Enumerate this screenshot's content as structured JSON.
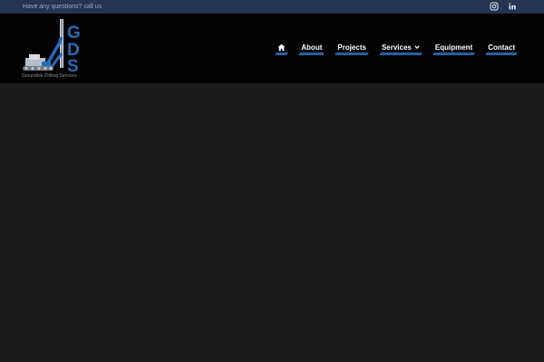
{
  "topbar": {
    "question_text": "Have any questions? call us",
    "social": [
      {
        "icon": "instagram-icon"
      },
      {
        "icon": "linkedin-icon"
      }
    ]
  },
  "logo": {
    "letters": [
      "G",
      "D",
      "S"
    ],
    "caption": "Groundtek Drilling Services"
  },
  "nav": {
    "home_icon": "home-icon",
    "items": [
      {
        "label": "About"
      },
      {
        "label": "Projects"
      },
      {
        "label": "Services",
        "has_dropdown": true
      },
      {
        "label": "Equipment"
      },
      {
        "label": "Contact"
      }
    ]
  },
  "colors": {
    "topbar_bg": "#243453",
    "header_bg": "#020202",
    "body_bg": "#1b1b1b",
    "accent_blue": "#1b6fc0"
  }
}
